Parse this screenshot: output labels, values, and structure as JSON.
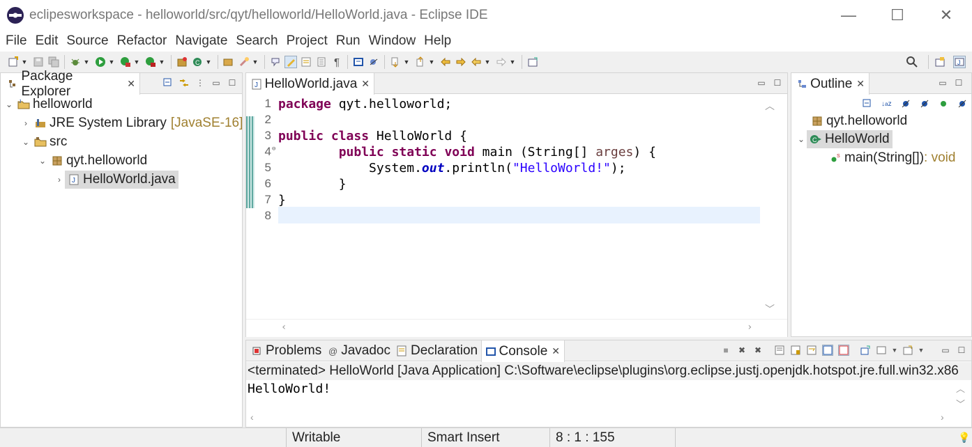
{
  "window": {
    "title": "eclipesworkspace - helloworld/src/qyt/helloworld/HelloWorld.java - Eclipse IDE",
    "minimize": "—",
    "maximize": "☐",
    "close": "✕"
  },
  "menu": [
    "File",
    "Edit",
    "Source",
    "Refactor",
    "Navigate",
    "Search",
    "Project",
    "Run",
    "Window",
    "Help"
  ],
  "package_explorer": {
    "tab_label": "Package Explorer",
    "tree": {
      "project": "helloworld",
      "jre_label": "JRE System Library",
      "jre_version": "[JavaSE-16]",
      "src": "src",
      "package": "qyt.helloworld",
      "file": "HelloWorld.java"
    }
  },
  "editor": {
    "tab_label": "HelloWorld.java",
    "line_numbers": [
      "1",
      "2",
      "3",
      "4",
      "5",
      "6",
      "7",
      "8"
    ],
    "code": {
      "l1_kw": "package",
      "l1_rest": " qyt.helloworld;",
      "l3_kw1": "public",
      "l3_kw2": "class",
      "l3_rest": " HelloWorld {",
      "l4_indent": "        ",
      "l4_kw1": "public",
      "l4_kw2": "static",
      "l4_kw3": "void",
      "l4_mid": " main (String[] ",
      "l4_arg": "arges",
      "l4_end": ") {",
      "l5_start": "            System.",
      "l5_field": "out",
      "l5_mid": ".println(",
      "l5_str": "\"HelloWorld!\"",
      "l5_end": ");",
      "l6": "        }",
      "l7": "}"
    }
  },
  "outline": {
    "tab_label": "Outline",
    "package": "qyt.helloworld",
    "class": "HelloWorld",
    "method": "main(String[])",
    "method_type": " : void"
  },
  "console_panel": {
    "tabs": {
      "problems": "Problems",
      "javadoc": "Javadoc",
      "declaration": "Declaration",
      "console": "Console"
    },
    "terminated_line": "<terminated> HelloWorld [Java Application] C:\\Software\\eclipse\\plugins\\org.eclipse.justj.openjdk.hotspot.jre.full.win32.x86",
    "output": "HelloWorld!"
  },
  "status": {
    "writable": "Writable",
    "insert_mode": "Smart Insert",
    "position": "8 : 1 : 155"
  },
  "colors": {
    "keyword": "#7f0055",
    "string": "#2a00ff",
    "field": "#0000c0",
    "current_line": "#e8f2fe",
    "selection": "#dadada"
  }
}
